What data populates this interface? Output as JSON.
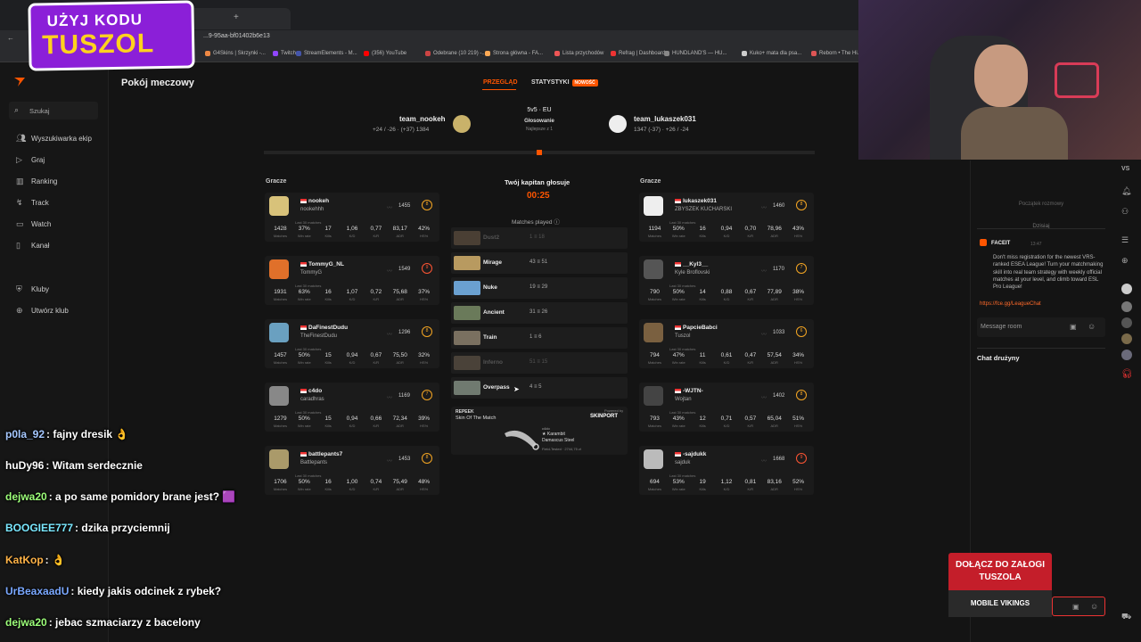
{
  "browser": {
    "url": "...9-95aa-bf01402b6e13",
    "bookmarks": [
      "G4Skins | Skrzynki -...",
      "Twitch",
      "StreamElements - M...",
      "(356) YouTube",
      "Odebrane (10 219) -...",
      "Strona główna - FA...",
      "Lista przychodów",
      "Refrag | Dashboard",
      "HUNDLAND'S — HU...",
      "Kuko+ mata dla psa...",
      "Reborn • The Hi..."
    ]
  },
  "sidebar": {
    "search": "Szukaj",
    "items": [
      "Wyszukiwarka ekip",
      "Graj",
      "Ranking",
      "Track",
      "Watch",
      "Kanał",
      "Kluby",
      "Utwórz klub"
    ]
  },
  "page": {
    "title": "Pokój meczowy",
    "tabs": [
      "PRZEGLĄD",
      "STATYSTYKI"
    ],
    "new_badge": "NOWOŚĆ",
    "mode": "5v5 · EU",
    "phase": "Głosowanie",
    "best_of": "Najlepsze z 1",
    "team_left": {
      "name": "team_nookeh",
      "stats": "+24 / -26 · (+37) 1384"
    },
    "team_right": {
      "name": "team_lukaszek031",
      "stats": "1347 (-37) · +26 / -24"
    },
    "players_label": "Gracze",
    "captain_label": "Twój kapitan głosuje",
    "timer": "00:25",
    "matches_played": "Matches played",
    "last30": "Last 30 matches",
    "stat_labels": [
      "Matches",
      "Win rate",
      "Kills",
      "K/D",
      "K/R",
      "ADR",
      "HS%"
    ]
  },
  "left_players": [
    {
      "nick": "nookeh",
      "sub": "nookehhh",
      "elo": "1455",
      "level": "8",
      "stats": [
        "1428",
        "37%",
        "17",
        "1,06",
        "0,77",
        "83,17",
        "42%"
      ]
    },
    {
      "nick": "TommyG_NL",
      "sub": "TommyG",
      "elo": "1549",
      "level": "9",
      "stats": [
        "1931",
        "63%",
        "16",
        "1,07",
        "0,72",
        "75,68",
        "37%"
      ]
    },
    {
      "nick": "DaFinestDudu",
      "sub": "TheFinestDudu",
      "elo": "1296",
      "level": "8",
      "stats": [
        "1457",
        "50%",
        "15",
        "0,94",
        "0,67",
        "75,50",
        "32%"
      ]
    },
    {
      "nick": "c4do",
      "sub": "caradhras",
      "elo": "1169",
      "level": "7",
      "stats": [
        "1279",
        "50%",
        "15",
        "0,94",
        "0,66",
        "72,34",
        "39%"
      ]
    },
    {
      "nick": "battlepants7",
      "sub": "Battlepants",
      "elo": "1453",
      "level": "8",
      "stats": [
        "1706",
        "50%",
        "16",
        "1,00",
        "0,74",
        "75,49",
        "48%"
      ]
    }
  ],
  "right_players": [
    {
      "nick": "lukaszek031",
      "sub": "ZBYSZEK KUCHARSKI",
      "elo": "1460",
      "level": "8",
      "stats": [
        "1194",
        "50%",
        "16",
        "0,94",
        "0,70",
        "78,96",
        "43%"
      ]
    },
    {
      "nick": "__Kyl3__",
      "sub": "Kyle Broflovski",
      "elo": "1170",
      "level": "7",
      "stats": [
        "790",
        "50%",
        "14",
        "0,88",
        "0,67",
        "77,89",
        "38%"
      ]
    },
    {
      "nick": "PapcieBabci",
      "sub": "Tuszol",
      "elo": "1033",
      "level": "6",
      "stats": [
        "794",
        "47%",
        "11",
        "0,61",
        "0,47",
        "57,54",
        "34%"
      ]
    },
    {
      "nick": "-WJTN-",
      "sub": "Wojtan",
      "elo": "1402",
      "level": "8",
      "stats": [
        "793",
        "43%",
        "12",
        "0,71",
        "0,57",
        "65,04",
        "51%"
      ]
    },
    {
      "nick": "-sajdukk",
      "sub": "sajduk",
      "elo": "1668",
      "level": "9",
      "stats": [
        "694",
        "53%",
        "19",
        "1,12",
        "0,81",
        "83,16",
        "52%"
      ]
    }
  ],
  "maps": [
    {
      "name": "Dust2",
      "stat": "1 ≡ 18",
      "dim": true,
      "color": "#a08060"
    },
    {
      "name": "Mirage",
      "stat": "43 ≡ 51",
      "dim": false,
      "color": "#b89a60"
    },
    {
      "name": "Nuke",
      "stat": "19 ≡ 29",
      "dim": false,
      "color": "#6aa0d0"
    },
    {
      "name": "Ancient",
      "stat": "31 ≡ 26",
      "dim": false,
      "color": "#6a7a5a"
    },
    {
      "name": "Train",
      "stat": "1 ≡ 6",
      "dim": false,
      "color": "#7a7060"
    },
    {
      "name": "Inferno",
      "stat": "51 ≡ 15",
      "dim": true,
      "color": "#a08a70"
    },
    {
      "name": "Overpass",
      "stat": "4 ≡ 5",
      "dim": false,
      "color": "#707a70"
    }
  ],
  "skin": {
    "brand": "REPEEK",
    "label": "Skin Of The Match",
    "powered": "Powered by",
    "sponsor": "SKINPORT",
    "owner": "c4do",
    "item": "★ Karambit",
    "finish": "Damascus Steel",
    "wear": "Field-Tested · 2744,75 zł"
  },
  "right_chat": {
    "top": "Początek rozmowy",
    "today": "Dzisiaj",
    "sender": "FACEIT",
    "time": "13:47",
    "message": "Don't miss registration for the newest VRS-ranked ESEA League! Turn your matchmaking skill into real team strategy with weekly official matches at your level, and climb toward ESL Pro League!",
    "link": "https://fce.gg/LeagueChat",
    "input_placeholder": "Message room",
    "team_chat": "Chat drużyny",
    "vs": "VS"
  },
  "overlay": {
    "promo_line1": "UŻYJ KODU",
    "promo_line2": "TUSZOL",
    "mv_line1": "DOŁĄCZ DO ZAŁOGI",
    "mv_line2": "TUSZOLA",
    "mv_brand": "MOBILE VIKINGS",
    "chat": [
      {
        "user": "p0la_92",
        "msg": "fajny dresik 👌",
        "color": "#a6c8ff"
      },
      {
        "user": "huDy96",
        "msg": "Witam serdecznie",
        "color": "#ffffff"
      },
      {
        "user": "dejwa20",
        "msg": "a po same pomidory brane jest? 🟪",
        "color": "#9dff7a"
      },
      {
        "user": "BOOGIEE777",
        "msg": "dzika przyciemnij",
        "color": "#7ae8ff"
      },
      {
        "user": "KatKop",
        "msg": "👌",
        "color": "#ffb347"
      },
      {
        "user": "UrBeaxaadU",
        "msg": "kiedy jakis odcinek z rybek?",
        "color": "#7aa8ff"
      },
      {
        "user": "dejwa20",
        "msg": "jebac szmaciarzy z bacelony",
        "color": "#9dff7a"
      }
    ]
  }
}
